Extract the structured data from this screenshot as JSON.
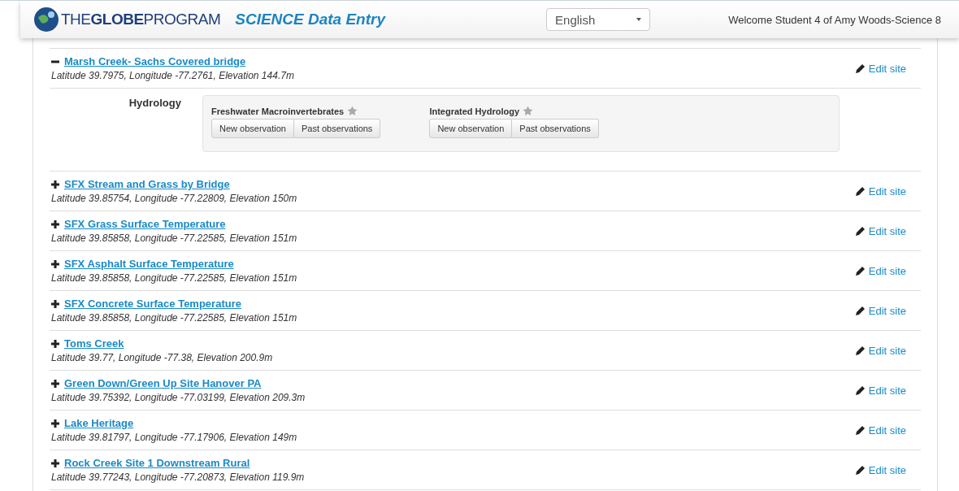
{
  "header": {
    "logo": "THE**GLOBE**PROGRAM",
    "app_title": "SCIENCE Data Entry",
    "language": "English",
    "welcome": "Welcome Student 4 of Amy Woods-Science 8"
  },
  "sites": [
    {
      "name": "Marsh Creek- Sachs Covered bridge",
      "coords": "Latitude 39.7975, Longitude -77.2761, Elevation 144.7m",
      "expanded": true,
      "edit": "Edit site",
      "groups": [
        {
          "label": "Hydrology",
          "protocols": [
            {
              "name": "Freshwater Macroinvertebrates",
              "buttons": [
                "New observation",
                "Past observations"
              ]
            },
            {
              "name": "Integrated Hydrology",
              "buttons": [
                "New observation",
                "Past observations"
              ]
            }
          ]
        }
      ]
    },
    {
      "name": "SFX Stream and Grass by Bridge",
      "coords": "Latitude 39.85754, Longitude -77.22809, Elevation 150m",
      "expanded": false,
      "edit": "Edit site"
    },
    {
      "name": "SFX Grass Surface Temperature",
      "coords": "Latitude 39.85858, Longitude -77.22585, Elevation 151m",
      "expanded": false,
      "edit": "Edit site"
    },
    {
      "name": "SFX Asphalt Surface Temperature",
      "coords": "Latitude 39.85858, Longitude -77.22585, Elevation 151m",
      "expanded": false,
      "edit": "Edit site"
    },
    {
      "name": "SFX Concrete Surface Temperature",
      "coords": "Latitude 39.85858, Longitude -77.22585, Elevation 151m",
      "expanded": false,
      "edit": "Edit site"
    },
    {
      "name": "Toms Creek",
      "coords": "Latitude 39.77, Longitude -77.38, Elevation 200.9m",
      "expanded": false,
      "edit": "Edit site"
    },
    {
      "name": "Green Down/Green Up Site Hanover PA",
      "coords": "Latitude 39.75392, Longitude -77.03199, Elevation 209.3m",
      "expanded": false,
      "edit": "Edit site"
    },
    {
      "name": "Lake Heritage",
      "coords": "Latitude 39.81797, Longitude -77.17906, Elevation 149m",
      "expanded": false,
      "edit": "Edit site"
    },
    {
      "name": "Rock Creek Site 1 Downstream Rural",
      "coords": "Latitude 39.77243, Longitude -77.20873, Elevation 119.9m",
      "expanded": false,
      "edit": "Edit site"
    }
  ]
}
